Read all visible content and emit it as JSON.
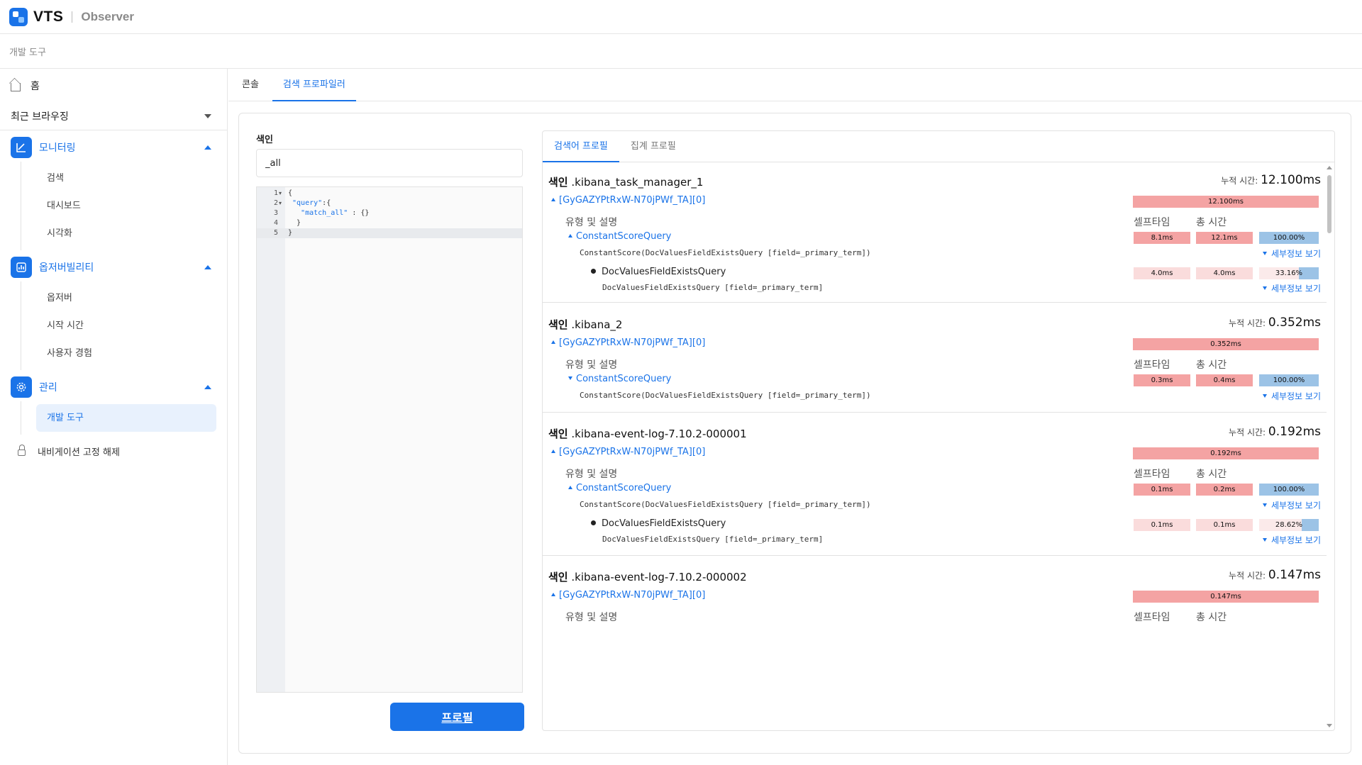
{
  "header": {
    "brand": "VTS",
    "subtitle": "Observer"
  },
  "breadcrumb": "개발 도구",
  "sidebar": {
    "home": "홈",
    "recent": "최근 브라우징",
    "groups": [
      {
        "label": "모니터링",
        "icon": "chart-line-icon",
        "items": [
          "검색",
          "대시보드",
          "시각화"
        ]
      },
      {
        "label": "옵저버빌리티",
        "icon": "bar-chart-icon",
        "items": [
          "옵저버",
          "시작 시간",
          "사용자 경험"
        ]
      },
      {
        "label": "관리",
        "icon": "gear-icon",
        "items": [
          "개발 도구"
        ]
      }
    ],
    "unpin": "내비게이션 고정 해제"
  },
  "tabs": [
    "콘솔",
    "검색 프로파일러"
  ],
  "query": {
    "index_label": "색인",
    "index_value": "_all",
    "lines": [
      {
        "n": "1",
        "fold": "▾",
        "code": "{"
      },
      {
        "n": "2",
        "fold": "▾",
        "key": " \"query\"",
        "rest": ":{"
      },
      {
        "n": "3",
        "fold": "",
        "key": "   \"match_all\"",
        "rest": " : {}"
      },
      {
        "n": "4",
        "fold": "",
        "code": "  }"
      },
      {
        "n": "5",
        "fold": "",
        "code": "}"
      }
    ],
    "profile_button": "프로필"
  },
  "results": {
    "tabs": [
      "검색어 프로필",
      "집계 프로필"
    ],
    "header_self": "셀프타임",
    "header_total": "총 시간",
    "header_type": "유형 및 설명",
    "cum_label": "누적 시간:",
    "index_prefix": "색인",
    "detail_label": "세부정보 보기",
    "sections": [
      {
        "index": ".kibana_task_manager_1",
        "cum": "12.100ms",
        "shard": "[GyGAZYPtRxW-N70jPWf_TA][0]",
        "shard_bar": "12.100ms",
        "query": "ConstantScoreQuery",
        "query_desc": "ConstantScore(DocValuesFieldExistsQuery [field=_primary_term])",
        "self": "8.1ms",
        "total": "12.1ms",
        "pct": "100.00%",
        "pct_value": 100,
        "sub": {
          "name": "DocValuesFieldExistsQuery",
          "desc": "DocValuesFieldExistsQuery [field=_primary_term]",
          "self": "4.0ms",
          "total": "4.0ms",
          "pct": "33.16%",
          "pct_value": 33.16
        }
      },
      {
        "index": ".kibana_2",
        "cum": "0.352ms",
        "shard": "[GyGAZYPtRxW-N70jPWf_TA][0]",
        "shard_bar": "0.352ms",
        "query": "ConstantScoreQuery",
        "query_desc": "ConstantScore(DocValuesFieldExistsQuery [field=_primary_term])",
        "self": "0.3ms",
        "total": "0.4ms",
        "pct": "100.00%",
        "pct_value": 100
      },
      {
        "index": ".kibana-event-log-7.10.2-000001",
        "cum": "0.192ms",
        "shard": "[GyGAZYPtRxW-N70jPWf_TA][0]",
        "shard_bar": "0.192ms",
        "query": "ConstantScoreQuery",
        "query_desc": "ConstantScore(DocValuesFieldExistsQuery [field=_primary_term])",
        "self": "0.1ms",
        "total": "0.2ms",
        "pct": "100.00%",
        "pct_value": 100,
        "sub": {
          "name": "DocValuesFieldExistsQuery",
          "desc": "DocValuesFieldExistsQuery [field=_primary_term]",
          "self": "0.1ms",
          "total": "0.1ms",
          "pct": "28.62%",
          "pct_value": 28.62
        }
      },
      {
        "index": ".kibana-event-log-7.10.2-000002",
        "cum": "0.147ms",
        "shard": "[GyGAZYPtRxW-N70jPWf_TA][0]",
        "shard_bar": "0.147ms"
      }
    ]
  },
  "colors": {
    "accent": "#1a73e8",
    "bar_red": "#f4a3a3",
    "bar_blue": "#9cc3e6"
  }
}
